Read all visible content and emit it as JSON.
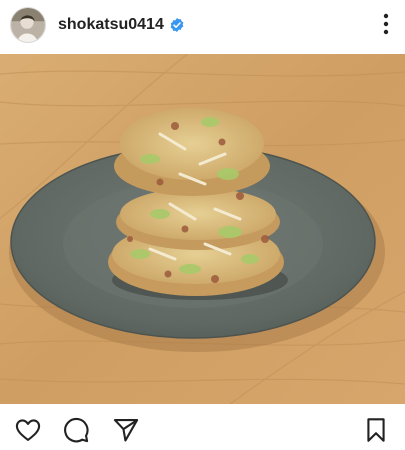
{
  "post": {
    "username": "shokatsu0414",
    "verified": true
  },
  "icons": {
    "avatar": "profile-avatar",
    "verified": "verified-badge-icon",
    "more": "more-options-icon",
    "like": "heart-icon",
    "comment": "comment-icon",
    "share": "paper-plane-icon",
    "save": "bookmark-icon"
  },
  "colors": {
    "verified_badge": "#3897f0",
    "text": "#222222"
  }
}
